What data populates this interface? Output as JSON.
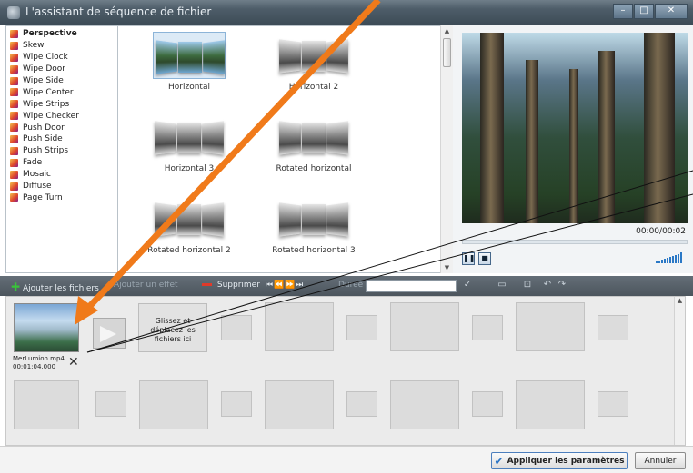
{
  "window": {
    "title": "L'assistant de séquence de fichier",
    "buttons": [
      "minimize",
      "maximize",
      "close"
    ]
  },
  "effects": {
    "items": [
      {
        "label": "Perspective",
        "selected": true
      },
      {
        "label": "Skew"
      },
      {
        "label": "Wipe Clock"
      },
      {
        "label": "Wipe Door"
      },
      {
        "label": "Wipe Side"
      },
      {
        "label": "Wipe Center"
      },
      {
        "label": "Wipe Strips"
      },
      {
        "label": "Wipe Checker"
      },
      {
        "label": "Push Door"
      },
      {
        "label": "Push Side"
      },
      {
        "label": "Push Strips"
      },
      {
        "label": "Fade"
      },
      {
        "label": "Mosaic"
      },
      {
        "label": "Diffuse"
      },
      {
        "label": "Page Turn"
      }
    ],
    "icon": "effect-icon"
  },
  "thumbnails": {
    "items": [
      {
        "label": "Horizontal",
        "selected": true
      },
      {
        "label": "Horizontal 2"
      },
      {
        "label": "Horizontal 3"
      },
      {
        "label": "Rotated horizontal"
      },
      {
        "label": "Rotated horizontal 2"
      },
      {
        "label": "Rotated horizontal 3"
      }
    ]
  },
  "preview": {
    "time": "00:00/00:02",
    "play_icon": "pause-icon",
    "stop_icon": "stop-icon",
    "volume_icon": "volume-icon"
  },
  "toolbar": {
    "add_files": "Ajouter les fichiers",
    "add_effect": "Ajouter un effet",
    "delete": "Supprimer",
    "duration_label": "Durée"
  },
  "timeline": {
    "clip": {
      "name": "MerLumion.mp4",
      "duration": "00:01:04.000"
    },
    "dropzone": "Glissez et déplacez les fichiers ici"
  },
  "footer": {
    "apply": "Appliquer les paramètres",
    "cancel": "Annuler"
  },
  "colors": {
    "annotation_arrow": "#f07a1a",
    "accent": "#2a74c6"
  }
}
